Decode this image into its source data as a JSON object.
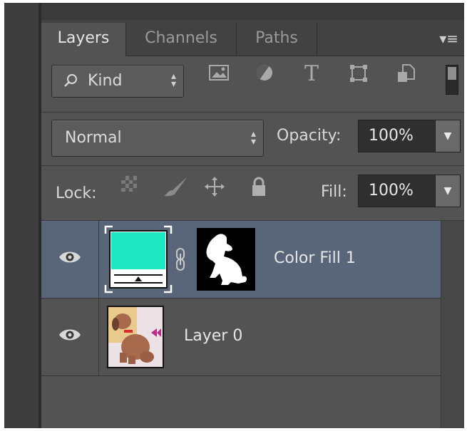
{
  "tabs": [
    "Layers",
    "Channels",
    "Paths"
  ],
  "panel_menu_icon": "panel-menu-icon",
  "filter": {
    "kind_label": "Kind",
    "icons": [
      "pixel-filter-icon",
      "adjustment-filter-icon",
      "type-filter-icon",
      "shape-filter-icon",
      "smart-object-filter-icon"
    ]
  },
  "blend": {
    "mode": "Normal",
    "opacity_label": "Opacity:",
    "opacity_value": "100%"
  },
  "lock": {
    "label": "Lock:",
    "icons": [
      "lock-transparent-icon",
      "lock-image-icon",
      "lock-position-icon",
      "lock-all-icon"
    ],
    "fill_label": "Fill:",
    "fill_value": "100%"
  },
  "layers": [
    {
      "name": "Color Fill 1",
      "selected": true,
      "fill_color": "#1de8c3"
    },
    {
      "name": "Layer 0",
      "selected": false
    }
  ],
  "colors": {
    "panel_bg": "#535353",
    "selected_row": "#596579",
    "fill_swatch": "#1de8c3"
  }
}
